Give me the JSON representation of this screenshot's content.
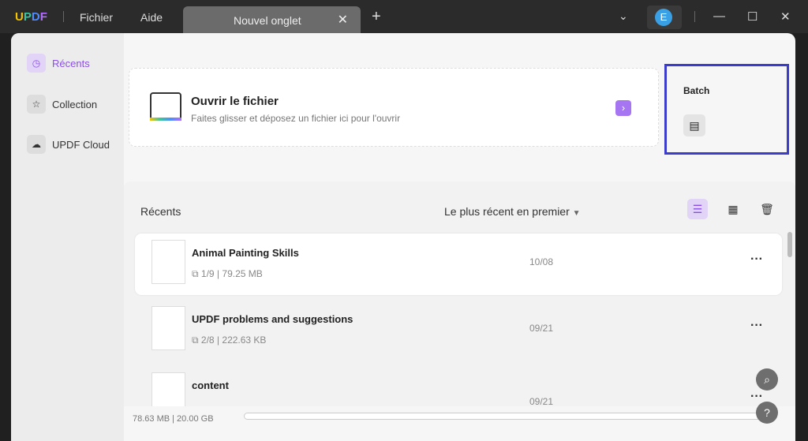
{
  "titlebar": {
    "logo": [
      "U",
      "P",
      "D",
      "F"
    ],
    "menu": [
      "Fichier",
      "Aide"
    ],
    "tab": "Nouvel onglet",
    "avatar": "E"
  },
  "sidebar": {
    "items": [
      {
        "label": "Récents",
        "icon": "clock-icon"
      },
      {
        "label": "Collection",
        "icon": "star-icon"
      },
      {
        "label": "UPDF Cloud",
        "icon": "cloud-icon"
      }
    ]
  },
  "open": {
    "title": "Ouvrir le fichier",
    "subtitle": "Faites glisser et déposez un fichier ici pour l'ouvrir"
  },
  "batch": {
    "title": "Batch"
  },
  "recent": {
    "title": "Récents",
    "sort": "Le plus récent en premier",
    "files": [
      {
        "name": "Animal Painting Skills",
        "pages": "1/9",
        "size": "79.25 MB",
        "date": "10/08"
      },
      {
        "name": "UPDF problems and suggestions",
        "pages": "2/8",
        "size": "222.63 KB",
        "date": "09/21"
      },
      {
        "name": "content",
        "date": "09/21"
      }
    ]
  },
  "status": {
    "storage": "78.63 MB | 20.00 GB",
    "storage_fraction": 0.004
  },
  "colors": {
    "accent": "#a675f2",
    "highlight": "#3c3ccc"
  }
}
